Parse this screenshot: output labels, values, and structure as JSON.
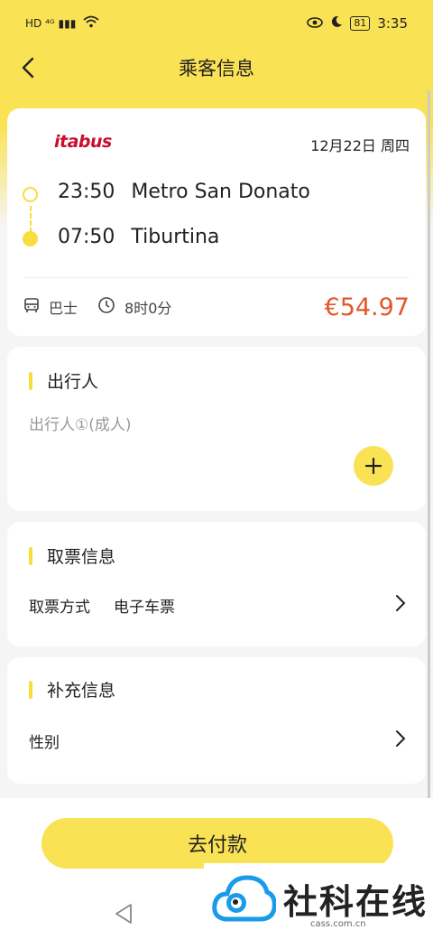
{
  "status_bar": {
    "left_icons": "HD ⁴ᴳ ▮▮▮",
    "battery": "81",
    "time": "3:35"
  },
  "header": {
    "title": "乘客信息"
  },
  "trip": {
    "operator": "itabus",
    "date": "12月22日 周四",
    "departure_time": "23:50",
    "departure_station": "Metro San Donato",
    "arrival_time": "07:50",
    "arrival_station": "Tiburtina",
    "vehicle": "巴士",
    "duration": "8时0分",
    "price": "€54.97"
  },
  "travelers": {
    "title": "出行人",
    "placeholder": "出行人①(成人)"
  },
  "ticket": {
    "title": "取票信息",
    "method_label": "取票方式",
    "method_value": "电子车票"
  },
  "extra": {
    "title": "补充信息",
    "gender_label": "性别"
  },
  "footer": {
    "pay_label": "去付款"
  },
  "watermark": {
    "text": "社科在线",
    "url": "cass.com.cn"
  },
  "colors": {
    "accent": "#fae255",
    "price": "#e2572a",
    "logo": "#c8102e"
  }
}
